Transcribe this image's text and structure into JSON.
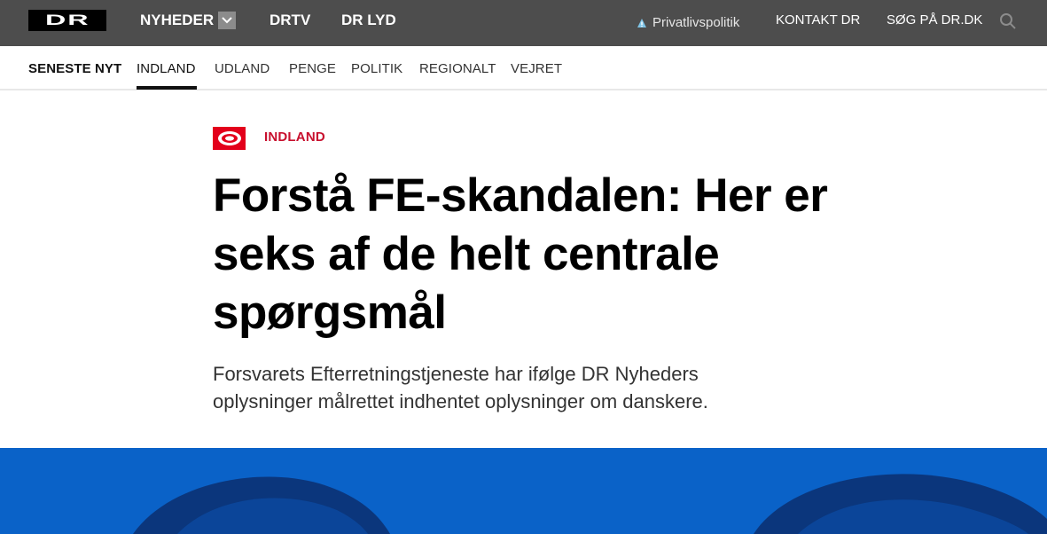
{
  "topbar": {
    "logo": "DR",
    "nav": [
      "NYHEDER",
      "DRTV",
      "DR LYD"
    ],
    "privacy": "Privatlivspolitik",
    "contact": "KONTAKT DR",
    "search": "SØG PÅ DR.DK"
  },
  "sections": {
    "items": [
      "SENESTE NYT",
      "INDLAND",
      "UDLAND",
      "PENGE",
      "POLITIK",
      "REGIONALT",
      "VEJRET"
    ],
    "active": "INDLAND"
  },
  "article": {
    "kicker": "INDLAND",
    "headline_bold": "Forstå FE-skandalen:",
    "headline_rest": " Her er seks af de helt centrale spørgsmål",
    "summary": "Forsvarets Efterretningstjeneste har ifølge DR Nyheders oplysninger målrettet indhentet oplysninger om danskere."
  },
  "colors": {
    "topbar_bg": "#4d4d4d",
    "accent_red": "#e3001b",
    "hero_blue": "#0a62c8"
  }
}
